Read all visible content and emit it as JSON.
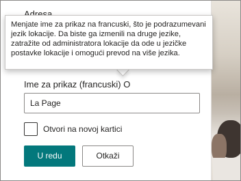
{
  "panel": {
    "address_label": "Adresa",
    "tooltip_text": "Menjate ime za prikaz na francuski, što je podrazumevani jezik lokacije. Da biste ga izmenili na druge jezike, zatražite od administratora lokacije da ode u jezičke postavke lokacije i omogući prevod na više jezika.",
    "display_name_label": "Ime za prikaz (francuski) O",
    "display_name_value": "La Page",
    "open_new_tab_label": "Otvori na novoj kartici",
    "open_new_tab_checked": false,
    "ok_button": "U redu",
    "cancel_button": "Otkaži"
  },
  "colors": {
    "primary": "#03787c",
    "border": "#8a8886",
    "text": "#201f1e"
  }
}
